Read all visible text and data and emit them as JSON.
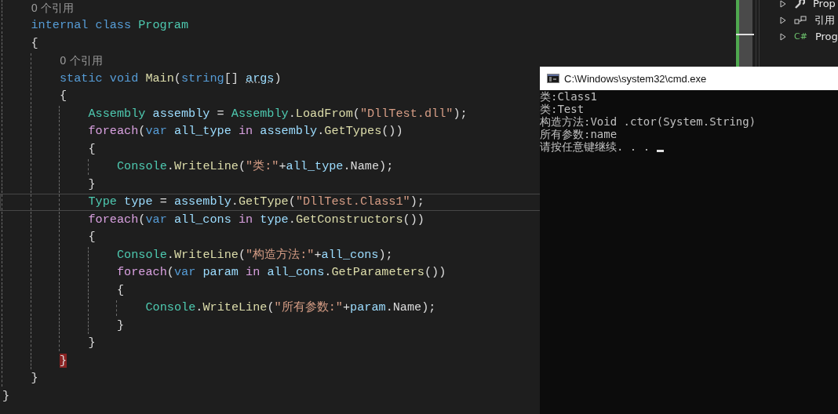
{
  "editor": {
    "lines": [
      {
        "current": false,
        "tokens": [
          {
            "kind": "lens",
            "text": "    0 个引用"
          }
        ]
      },
      {
        "current": false,
        "tokens": [
          {
            "kind": "kw",
            "text": "    internal "
          },
          {
            "kind": "kw",
            "text": "class "
          },
          {
            "kind": "type",
            "text": "Program"
          }
        ]
      },
      {
        "current": false,
        "tokens": [
          {
            "kind": "p",
            "text": "    {"
          }
        ]
      },
      {
        "current": false,
        "tokens": [
          {
            "kind": "lens",
            "text": "        0 个引用"
          }
        ]
      },
      {
        "current": false,
        "tokens": [
          {
            "kind": "kw",
            "text": "        static "
          },
          {
            "kind": "kw",
            "text": "void "
          },
          {
            "kind": "method",
            "text": "Main"
          },
          {
            "kind": "p",
            "text": "("
          },
          {
            "kind": "kw",
            "text": "string"
          },
          {
            "kind": "p",
            "text": "[] "
          },
          {
            "kind": "unused",
            "text": "args"
          },
          {
            "kind": "p",
            "text": ")"
          }
        ]
      },
      {
        "current": false,
        "tokens": [
          {
            "kind": "p",
            "text": "        {"
          }
        ]
      },
      {
        "current": false,
        "tokens": [
          {
            "kind": "type",
            "text": "            Assembly "
          },
          {
            "kind": "var",
            "text": "assembly"
          },
          {
            "kind": "p",
            "text": " = "
          },
          {
            "kind": "type",
            "text": "Assembly"
          },
          {
            "kind": "p",
            "text": "."
          },
          {
            "kind": "method",
            "text": "LoadFrom"
          },
          {
            "kind": "p",
            "text": "("
          },
          {
            "kind": "str",
            "text": "\"DllTest.dll\""
          },
          {
            "kind": "p",
            "text": ");"
          }
        ]
      },
      {
        "current": false,
        "tokens": [
          {
            "kind": "ctl",
            "text": "            foreach"
          },
          {
            "kind": "p",
            "text": "("
          },
          {
            "kind": "kw",
            "text": "var "
          },
          {
            "kind": "var",
            "text": "all_type "
          },
          {
            "kind": "ctl",
            "text": "in "
          },
          {
            "kind": "var",
            "text": "assembly"
          },
          {
            "kind": "p",
            "text": "."
          },
          {
            "kind": "method",
            "text": "GetTypes"
          },
          {
            "kind": "p",
            "text": "())"
          }
        ]
      },
      {
        "current": false,
        "tokens": [
          {
            "kind": "p",
            "text": "            {"
          }
        ]
      },
      {
        "current": false,
        "tokens": [
          {
            "kind": "type",
            "text": "                Console"
          },
          {
            "kind": "p",
            "text": "."
          },
          {
            "kind": "method",
            "text": "WriteLine"
          },
          {
            "kind": "p",
            "text": "("
          },
          {
            "kind": "str",
            "text": "\"类:\""
          },
          {
            "kind": "p",
            "text": "+"
          },
          {
            "kind": "var",
            "text": "all_type"
          },
          {
            "kind": "p",
            "text": ".Name);"
          }
        ]
      },
      {
        "current": false,
        "tokens": [
          {
            "kind": "p",
            "text": "            }"
          }
        ]
      },
      {
        "current": true,
        "tokens": [
          {
            "kind": "type",
            "text": "            Type "
          },
          {
            "kind": "var",
            "text": "type"
          },
          {
            "kind": "p",
            "text": " = "
          },
          {
            "kind": "var",
            "text": "assembly"
          },
          {
            "kind": "p",
            "text": "."
          },
          {
            "kind": "method",
            "text": "GetType"
          },
          {
            "kind": "p",
            "text": "("
          },
          {
            "kind": "str",
            "text": "\"DllTest.Class1\""
          },
          {
            "kind": "p",
            "text": ");"
          }
        ]
      },
      {
        "current": false,
        "tokens": [
          {
            "kind": "ctl",
            "text": "            foreach"
          },
          {
            "kind": "p",
            "text": "("
          },
          {
            "kind": "kw",
            "text": "var "
          },
          {
            "kind": "var",
            "text": "all_cons "
          },
          {
            "kind": "ctl",
            "text": "in "
          },
          {
            "kind": "var",
            "text": "type"
          },
          {
            "kind": "p",
            "text": "."
          },
          {
            "kind": "method",
            "text": "GetConstructors"
          },
          {
            "kind": "p",
            "text": "())"
          }
        ]
      },
      {
        "current": false,
        "tokens": [
          {
            "kind": "p",
            "text": "            {"
          }
        ]
      },
      {
        "current": false,
        "tokens": [
          {
            "kind": "type",
            "text": "                Console"
          },
          {
            "kind": "p",
            "text": "."
          },
          {
            "kind": "method",
            "text": "WriteLine"
          },
          {
            "kind": "p",
            "text": "("
          },
          {
            "kind": "str",
            "text": "\"构造方法:\""
          },
          {
            "kind": "p",
            "text": "+"
          },
          {
            "kind": "var",
            "text": "all_cons"
          },
          {
            "kind": "p",
            "text": ");"
          }
        ]
      },
      {
        "current": false,
        "tokens": [
          {
            "kind": "ctl",
            "text": "                foreach"
          },
          {
            "kind": "p",
            "text": "("
          },
          {
            "kind": "kw",
            "text": "var "
          },
          {
            "kind": "var",
            "text": "param "
          },
          {
            "kind": "ctl",
            "text": "in "
          },
          {
            "kind": "var",
            "text": "all_cons"
          },
          {
            "kind": "p",
            "text": "."
          },
          {
            "kind": "method",
            "text": "GetParameters"
          },
          {
            "kind": "p",
            "text": "())"
          }
        ]
      },
      {
        "current": false,
        "tokens": [
          {
            "kind": "p",
            "text": "                {"
          }
        ]
      },
      {
        "current": false,
        "tokens": [
          {
            "kind": "type",
            "text": "                    Console"
          },
          {
            "kind": "p",
            "text": "."
          },
          {
            "kind": "method",
            "text": "WriteLine"
          },
          {
            "kind": "p",
            "text": "("
          },
          {
            "kind": "str",
            "text": "\"所有参数:\""
          },
          {
            "kind": "p",
            "text": "+"
          },
          {
            "kind": "var",
            "text": "param"
          },
          {
            "kind": "p",
            "text": ".Name);"
          }
        ]
      },
      {
        "current": false,
        "tokens": [
          {
            "kind": "p",
            "text": "                }"
          }
        ]
      },
      {
        "current": false,
        "tokens": [
          {
            "kind": "p",
            "text": "            }"
          }
        ]
      },
      {
        "current": false,
        "tokens": [
          {
            "kind": "brace",
            "text": "        }"
          }
        ]
      },
      {
        "current": false,
        "tokens": [
          {
            "kind": "p",
            "text": "    }"
          }
        ]
      },
      {
        "current": false,
        "tokens": [
          {
            "kind": "p",
            "text": "}"
          }
        ]
      }
    ]
  },
  "solution_explorer": {
    "items": [
      {
        "kind": "wrench",
        "label": "Prop",
        "expanded": false
      },
      {
        "kind": "references",
        "label": "引用",
        "expanded": false
      },
      {
        "kind": "csharp",
        "badge": "C#",
        "label": "Prog",
        "expanded": false
      }
    ]
  },
  "console_window": {
    "title": "C:\\Windows\\system32\\cmd.exe",
    "lines": [
      "类:Class1",
      "类:Test",
      "构造方法:Void .ctor(System.String)",
      "所有参数:name",
      "请按任意键继续. . . "
    ]
  }
}
